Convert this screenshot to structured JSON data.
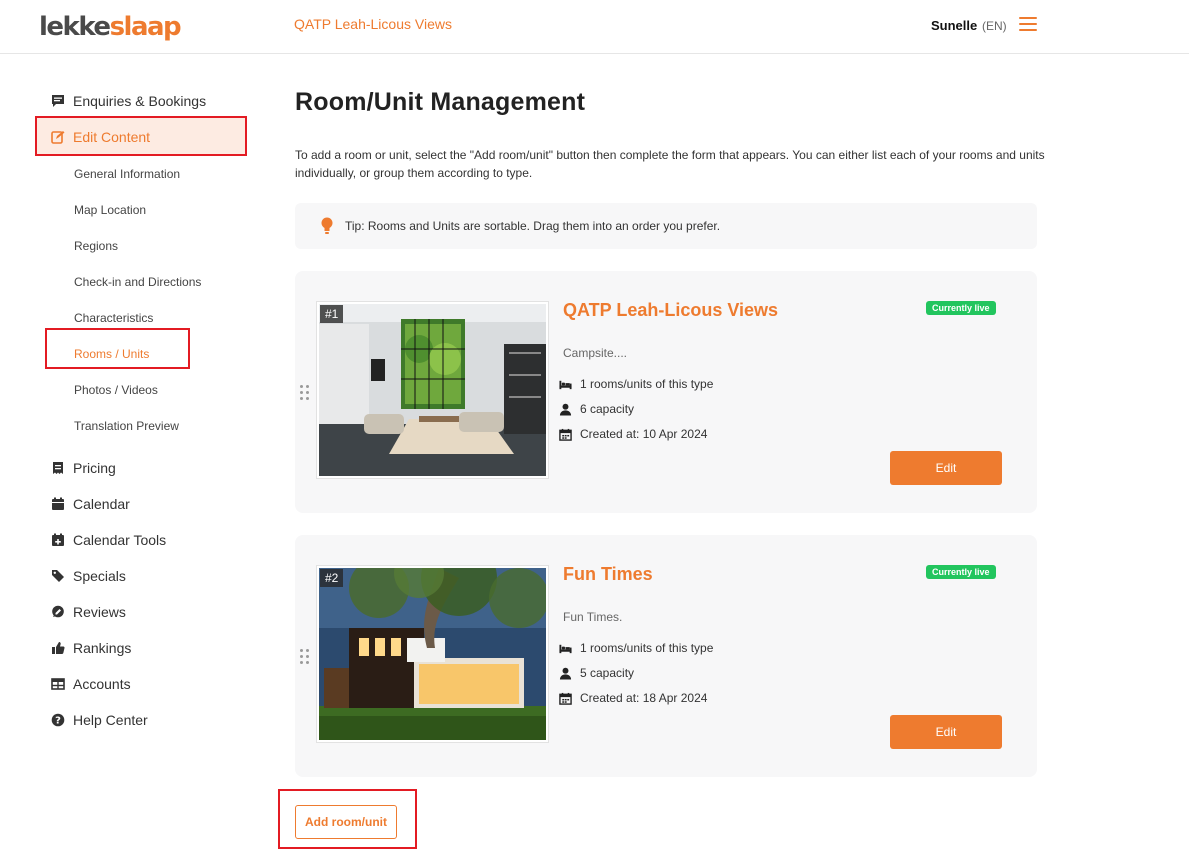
{
  "header": {
    "logo_part1": "lekke",
    "logo_part2": "slaap",
    "property_name": "QATP Leah-Licous Views",
    "user_name": "Sunelle",
    "language": "(EN)"
  },
  "sidebar": {
    "items": [
      {
        "label": "Enquiries & Bookings",
        "icon": "message-icon"
      },
      {
        "label": "Edit Content",
        "icon": "edit-icon"
      },
      {
        "label": "Pricing",
        "icon": "receipt-icon"
      },
      {
        "label": "Calendar",
        "icon": "calendar-icon"
      },
      {
        "label": "Calendar Tools",
        "icon": "calendar-plus-icon"
      },
      {
        "label": "Specials",
        "icon": "tags-icon"
      },
      {
        "label": "Reviews",
        "icon": "comment-icon"
      },
      {
        "label": "Rankings",
        "icon": "thumbs-up-icon"
      },
      {
        "label": "Accounts",
        "icon": "table-icon"
      },
      {
        "label": "Help Center",
        "icon": "question-icon"
      }
    ],
    "sub_items": [
      "General Information",
      "Map Location",
      "Regions",
      "Check-in and Directions",
      "Characteristics",
      "Rooms / Units",
      "Photos / Videos",
      "Translation Preview"
    ]
  },
  "main": {
    "title": "Room/Unit Management",
    "intro": "To add a room or unit, select the \"Add room/unit\" button then complete the form that appears. You can either list each of your rooms and units individually, or group them according to type.",
    "tip": "Tip: Rooms and Units are sortable. Drag them into an order you prefer.",
    "units": [
      {
        "number": "#1",
        "name": "QATP Leah-Licous Views",
        "status": "Currently live",
        "description": "Campsite....",
        "rooms": "1 rooms/units of this type",
        "capacity": "6 capacity",
        "created": "Created at: 10 Apr 2024",
        "edit_label": "Edit"
      },
      {
        "number": "#2",
        "name": "Fun Times",
        "status": "Currently live",
        "description": "Fun Times.",
        "rooms": "1 rooms/units of this type",
        "capacity": "5 capacity",
        "created": "Created at: 18 Apr 2024",
        "edit_label": "Edit"
      }
    ],
    "add_label": "Add room/unit"
  },
  "colors": {
    "accent": "#ee7b2f",
    "live": "#22c55e",
    "highlight": "#e31b23"
  }
}
